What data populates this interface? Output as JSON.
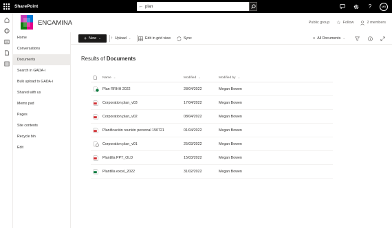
{
  "suitebar": {
    "brand": "SharePoint",
    "search_value": "plan",
    "avatar_initials": "MB"
  },
  "site": {
    "title": "ENCAMINA",
    "group_type": "Public group",
    "follow_label": "Follow",
    "members_label": "2 members"
  },
  "nav": {
    "items": [
      {
        "label": "Home",
        "active": false
      },
      {
        "label": "Conversations",
        "active": false
      },
      {
        "label": "Documents",
        "active": true
      },
      {
        "label": "Search in GADA-i",
        "active": false
      },
      {
        "label": "Bulk upload to GADA-i",
        "active": false
      },
      {
        "label": "Shared with us",
        "active": false
      },
      {
        "label": "Memo pad",
        "active": false
      },
      {
        "label": "Pages",
        "active": false
      },
      {
        "label": "Site contents",
        "active": false
      },
      {
        "label": "Recycle bin",
        "active": false
      },
      {
        "label": "Edit",
        "active": false
      }
    ]
  },
  "command": {
    "new_label": "New",
    "upload_label": "Upload",
    "grid_label": "Edit in grid view",
    "sync_label": "Sync",
    "view_label": "All Documents"
  },
  "results": {
    "prefix": "Results of",
    "library": "Documents"
  },
  "table": {
    "headers": {
      "name": "Name",
      "modified": "Modified",
      "modified_by": "Modified by"
    },
    "rows": [
      {
        "name": "Plan RRHH 2022",
        "modified": "28/04/2022",
        "modified_by": "Megan Bowen",
        "icon": "sync-doc-icon"
      },
      {
        "name": "Corporation plan_v03",
        "modified": "17/04/2022",
        "modified_by": "Megan Bowen",
        "icon": "pdf-icon"
      },
      {
        "name": "Corporation plan_v02",
        "modified": "08/04/2022",
        "modified_by": "Megan Bowen",
        "icon": "pdf-icon"
      },
      {
        "name": "Planificación reunión personal 150721",
        "modified": "01/04/2022",
        "modified_by": "Megan Bowen",
        "icon": "pdf-icon"
      },
      {
        "name": "Corporation plan_v01",
        "modified": "25/03/2022",
        "modified_by": "Megan Bowen",
        "icon": "link-doc-icon"
      },
      {
        "name": "Plantilla PPT_OLD",
        "modified": "15/03/2022",
        "modified_by": "Megan Bowen",
        "icon": "pdf-icon"
      },
      {
        "name": "Plantilla excel_2022",
        "modified": "31/02/2022",
        "modified_by": "Megan Bowen",
        "icon": "excel-icon"
      }
    ]
  },
  "colors": {
    "suitebar": "#000000",
    "accent": "#1b1a19",
    "pdf": "#d13438",
    "excel": "#107c41",
    "logo": [
      "#c239b3",
      "#0078d4",
      "#107c10",
      "#e3008c"
    ]
  }
}
